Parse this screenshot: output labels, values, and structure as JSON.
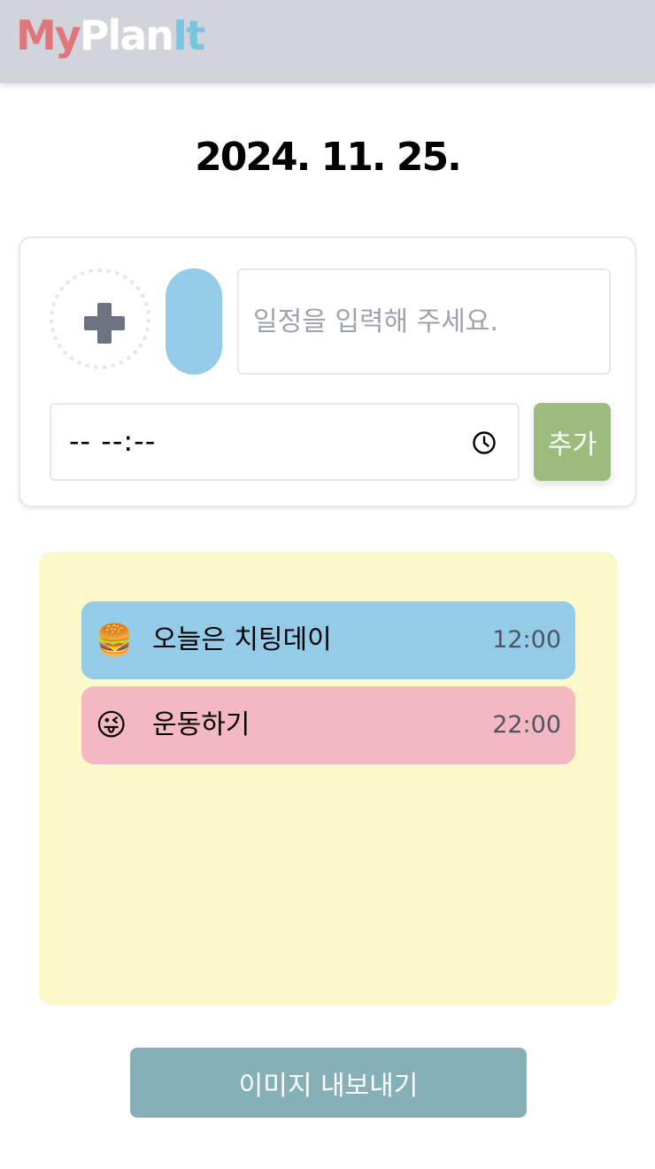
{
  "header": {
    "logo_parts": [
      "My",
      "Plan",
      "It"
    ],
    "logo_colors": [
      "#e0767b",
      "#ffffff",
      "#78c4e3"
    ]
  },
  "date_title": "2024. 11. 25.",
  "form": {
    "emoji_picker_icon": "plus-icon",
    "selected_color": "#93cbe8",
    "text_input_value": "",
    "text_input_placeholder": "일정을 입력해 주세요.",
    "time_input_value": "-- --:--",
    "time_icon": "clock-icon",
    "add_label": "추가",
    "add_color": "#9bbc7d"
  },
  "board": {
    "background": "#fdf8c9",
    "items": [
      {
        "emoji": "🍔",
        "title": "오늘은 치팅데이",
        "time": "12:00",
        "color": "#93cbe8"
      },
      {
        "emoji": "😜",
        "title": "운동하기",
        "time": "22:00",
        "color": "#f4b8c3"
      }
    ]
  },
  "export_label": "이미지 내보내기",
  "export_color": "#85b0b8"
}
